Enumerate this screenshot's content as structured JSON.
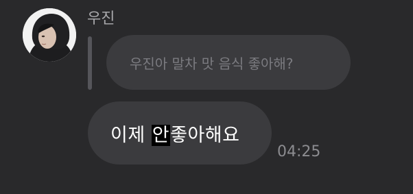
{
  "chat": {
    "sender_name": "우진",
    "avatar_icon": "person-hoodie-photo",
    "reply": {
      "quoted_text": "우진아 말차 맛 음식 좋아해?"
    },
    "message": {
      "text_before": "이제 ",
      "text_highlight": "안",
      "text_after": "좋아해요",
      "time": "04:25"
    }
  },
  "colors": {
    "background": "#29292b",
    "bubble": "#3b3b3e",
    "sender_text": "#a8a8ab",
    "quoted_text": "#7b7b80",
    "message_text": "#ffffff",
    "highlight": "#000000",
    "timestamp": "#8c8c90"
  }
}
